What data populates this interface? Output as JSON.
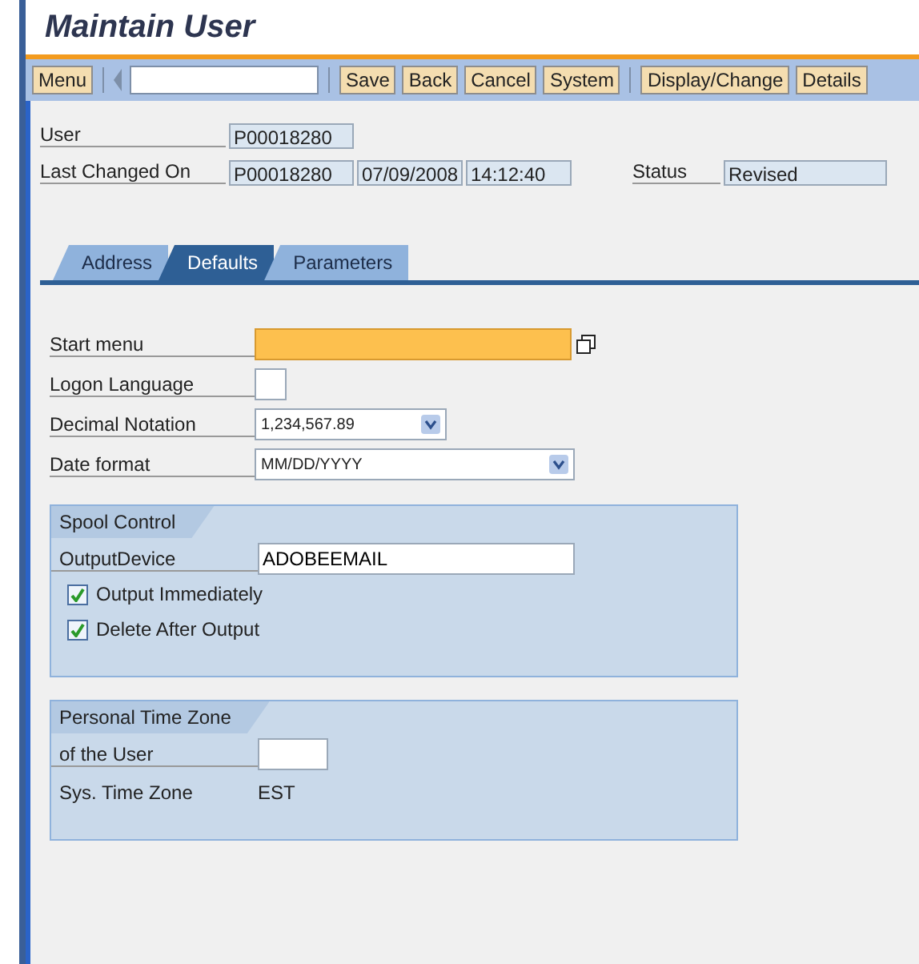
{
  "window": {
    "title": "Maintain User"
  },
  "toolbar": {
    "menu_button": "Menu",
    "buttons": [
      "Save",
      "Back",
      "Cancel",
      "System",
      "Display/Change",
      "Details"
    ]
  },
  "header_fields": [
    {
      "label": "User",
      "values": [
        "P00018280"
      ]
    },
    {
      "label": "Last Changed On",
      "values": [
        "P00018280",
        "07/09/2008",
        "14:12:40"
      ],
      "extra_label": "Status",
      "extra_value": "Revised"
    }
  ],
  "tabs": [
    {
      "label": "Address",
      "selected": false
    },
    {
      "label": "Defaults",
      "selected": true
    },
    {
      "label": "Parameters",
      "selected": false
    }
  ],
  "defaults": [
    {
      "kind": "input",
      "label": "Start menu",
      "focused": true
    },
    {
      "kind": "input",
      "label": "Logon Language",
      "focused": false
    },
    {
      "kind": "dropdown",
      "label": "Decimal Notation",
      "value": "1,234,567.89"
    },
    {
      "kind": "dropdown",
      "label": "Date format",
      "value": "MM/DD/YYYY"
    }
  ],
  "groups": [
    {
      "title": "Spool Control",
      "rows": [
        {
          "kind": "input",
          "label": "OutputDevice",
          "value": "ADOBEEMAIL"
        },
        {
          "kind": "checkbox",
          "label": "Output Immediately",
          "checked": true
        },
        {
          "kind": "checkbox",
          "label": "Delete After Output",
          "checked": true
        }
      ]
    },
    {
      "title": "Personal Time Zone",
      "rows": [
        {
          "kind": "input",
          "label": "of the User"
        },
        {
          "kind": "text",
          "label": "Sys. Time Zone",
          "value": "EST"
        }
      ]
    }
  ]
}
